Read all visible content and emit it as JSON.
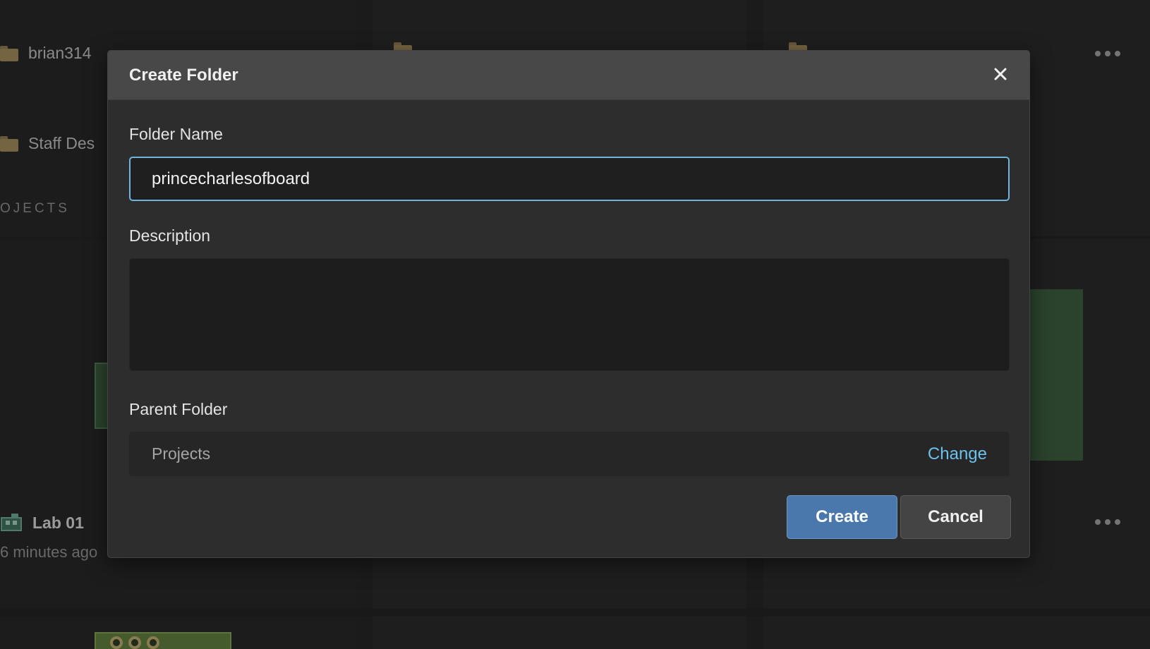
{
  "background": {
    "folders": [
      {
        "name": "brian314"
      },
      {
        "name": "Staff Des"
      }
    ],
    "section_caption": "OJECTS",
    "project": {
      "name": "Lab 01",
      "time": "6 minutes ago"
    }
  },
  "dialog": {
    "title": "Create Folder",
    "folder_name_label": "Folder Name",
    "folder_name_value": "princecharlesofboard",
    "description_label": "Description",
    "description_value": "",
    "parent_folder_label": "Parent Folder",
    "parent_folder_value": "Projects",
    "change_label": "Change",
    "create_label": "Create",
    "cancel_label": "Cancel"
  },
  "colors": {
    "accent": "#4a78ad",
    "link": "#6cc0ec",
    "focus_border": "#6fb4dc"
  }
}
